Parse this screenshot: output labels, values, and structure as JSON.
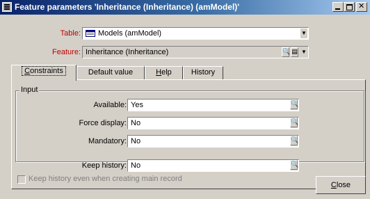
{
  "window": {
    "title": "Feature parameters 'Inheritance (Inheritance) (amModel)'"
  },
  "header": {
    "table_label": "Table:",
    "table_value": "Models (amModel)",
    "feature_label": "Feature:",
    "feature_value": "Inheritance (Inheritance)"
  },
  "tabs": [
    {
      "label_first": "C",
      "label_rest": "onstraints"
    },
    {
      "label": "Default value"
    },
    {
      "label_first": "H",
      "label_rest": "elp"
    },
    {
      "label": "History"
    }
  ],
  "input_group": {
    "title": "Input",
    "available_label": "Available:",
    "available_value": "Yes",
    "force_display_label": "Force display:",
    "force_display_value": "No",
    "mandatory_label": "Mandatory:",
    "mandatory_value": "No"
  },
  "keep_history": {
    "label": "Keep history:",
    "value": "No"
  },
  "keep_history_main_record": {
    "label": "Keep history even when creating main record",
    "checked": false
  },
  "close_button": {
    "label_first": "C",
    "label_rest": "lose"
  },
  "colors": {
    "title_start": "#0a246a",
    "title_end": "#a6caf0",
    "mandatory_label": "#c00000",
    "dialog_bg": "#d4d0c8"
  },
  "icons": {
    "title": "feature-app-icon",
    "table": "table-icon",
    "zoom": "magnifier-icon",
    "list": "list-icon",
    "dropdown": "chevron-down-icon"
  }
}
